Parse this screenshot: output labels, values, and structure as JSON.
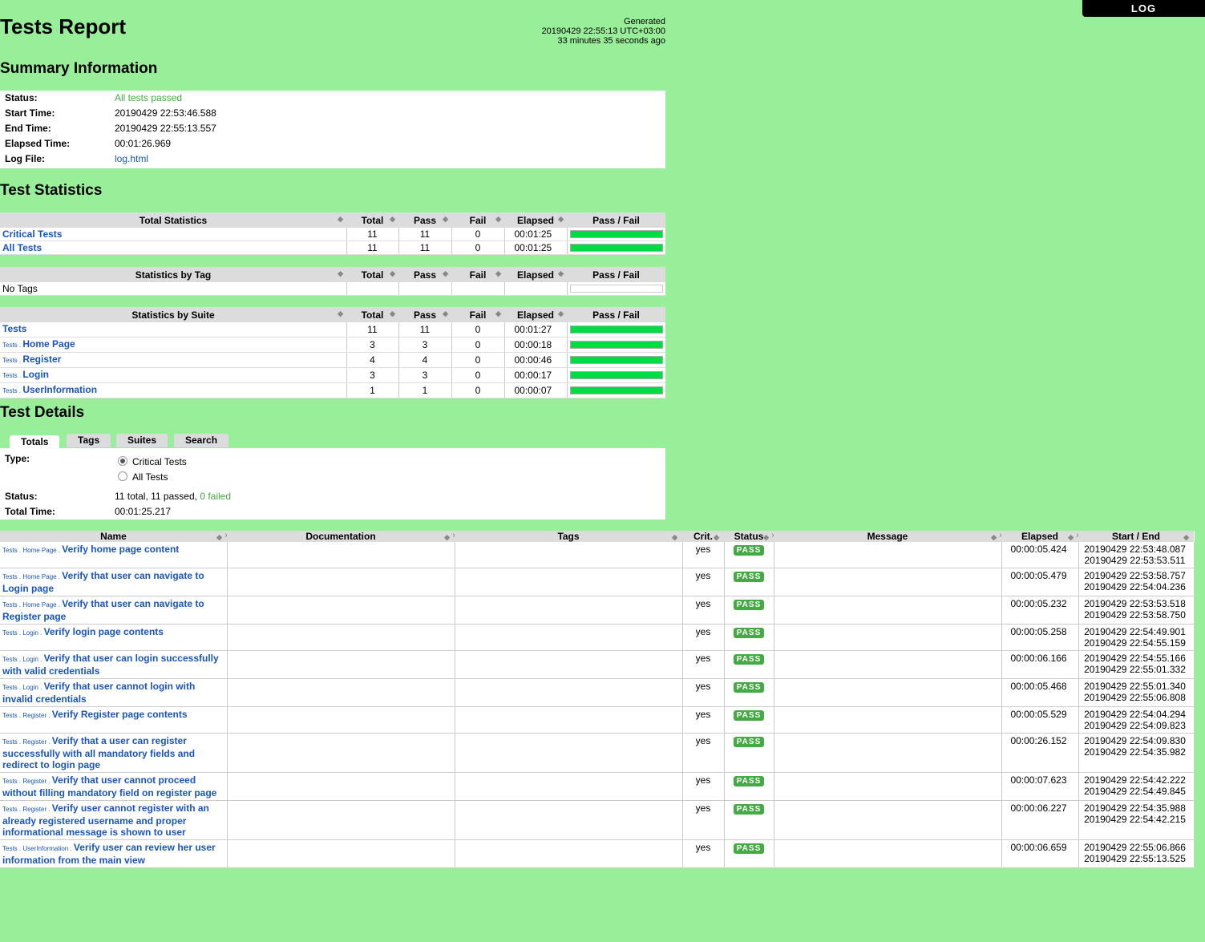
{
  "header": {
    "title": "Tests Report",
    "generated_label": "Generated",
    "generated_time": "20190429 22:55:13 UTC+03:00",
    "generated_ago": "33 minutes 35 seconds ago",
    "log_button": "LOG"
  },
  "summary": {
    "heading": "Summary Information",
    "status_label": "Status:",
    "status_value": "All tests passed",
    "start_label": "Start Time:",
    "start_value": "20190429 22:53:46.588",
    "end_label": "End Time:",
    "end_value": "20190429 22:55:13.557",
    "elapsed_label": "Elapsed Time:",
    "elapsed_value": "00:01:26.969",
    "logfile_label": "Log File:",
    "logfile_value": "log.html"
  },
  "statistics": {
    "heading": "Test Statistics",
    "cols": {
      "total": "Total",
      "pass": "Pass",
      "fail": "Fail",
      "elapsed": "Elapsed",
      "passfail": "Pass / Fail"
    },
    "total_title": "Total Statistics",
    "total_rows": [
      {
        "name": "Critical Tests",
        "total": "11",
        "pass": "11",
        "fail": "0",
        "elapsed": "00:01:25"
      },
      {
        "name": "All Tests",
        "total": "11",
        "pass": "11",
        "fail": "0",
        "elapsed": "00:01:25"
      }
    ],
    "tag_title": "Statistics by Tag",
    "tag_rows": [
      {
        "name": "No Tags"
      }
    ],
    "suite_title": "Statistics by Suite",
    "suite_rows": [
      {
        "prefix": "",
        "name": "Tests",
        "total": "11",
        "pass": "11",
        "fail": "0",
        "elapsed": "00:01:27"
      },
      {
        "prefix": "Tests . ",
        "name": "Home Page",
        "total": "3",
        "pass": "3",
        "fail": "0",
        "elapsed": "00:00:18"
      },
      {
        "prefix": "Tests . ",
        "name": "Register",
        "total": "4",
        "pass": "4",
        "fail": "0",
        "elapsed": "00:00:46"
      },
      {
        "prefix": "Tests . ",
        "name": "Login",
        "total": "3",
        "pass": "3",
        "fail": "0",
        "elapsed": "00:00:17"
      },
      {
        "prefix": "Tests . ",
        "name": "UserInformation",
        "total": "1",
        "pass": "1",
        "fail": "0",
        "elapsed": "00:00:07"
      }
    ]
  },
  "details": {
    "heading": "Test Details",
    "tabs": [
      "Totals",
      "Tags",
      "Suites",
      "Search"
    ],
    "type_label": "Type:",
    "option_critical": "Critical Tests",
    "option_all": "All Tests",
    "status_label": "Status:",
    "status_total": "11 total, 11 passed,",
    "status_failed": "0 failed",
    "totaltime_label": "Total Time:",
    "totaltime_value": "00:01:25.217",
    "columns": {
      "name": "Name",
      "doc": "Documentation",
      "tags": "Tags",
      "crit": "Crit.",
      "status": "Status",
      "message": "Message",
      "elapsed": "Elapsed",
      "startend": "Start / End"
    },
    "rows": [
      {
        "prefix": "Tests . Home Page . ",
        "name": "Verify home page content",
        "crit": "yes",
        "status": "PASS",
        "elapsed": "00:00:05.424",
        "start": "20190429 22:53:48.087",
        "end": "20190429 22:53:53.511"
      },
      {
        "prefix": "Tests . Home Page . ",
        "name": "Verify that user can navigate to Login page",
        "crit": "yes",
        "status": "PASS",
        "elapsed": "00:00:05.479",
        "start": "20190429 22:53:58.757",
        "end": "20190429 22:54:04.236"
      },
      {
        "prefix": "Tests . Home Page . ",
        "name": "Verify that user can navigate to Register page",
        "crit": "yes",
        "status": "PASS",
        "elapsed": "00:00:05.232",
        "start": "20190429 22:53:53.518",
        "end": "20190429 22:53:58.750"
      },
      {
        "prefix": "Tests . Login . ",
        "name": "Verify login page contents",
        "crit": "yes",
        "status": "PASS",
        "elapsed": "00:00:05.258",
        "start": "20190429 22:54:49.901",
        "end": "20190429 22:54:55.159"
      },
      {
        "prefix": "Tests . Login . ",
        "name": "Verify that user can login successfully with valid credentials",
        "crit": "yes",
        "status": "PASS",
        "elapsed": "00:00:06.166",
        "start": "20190429 22:54:55.166",
        "end": "20190429 22:55:01.332"
      },
      {
        "prefix": "Tests . Login . ",
        "name": "Verify that user cannot login with invalid credentials",
        "crit": "yes",
        "status": "PASS",
        "elapsed": "00:00:05.468",
        "start": "20190429 22:55:01.340",
        "end": "20190429 22:55:06.808"
      },
      {
        "prefix": "Tests . Register . ",
        "name": "Verify Register page contents",
        "crit": "yes",
        "status": "PASS",
        "elapsed": "00:00:05.529",
        "start": "20190429 22:54:04.294",
        "end": "20190429 22:54:09.823"
      },
      {
        "prefix": "Tests . Register . ",
        "name": "Verify that a user can register successfully with all mandatory fields and redirect to login page",
        "crit": "yes",
        "status": "PASS",
        "elapsed": "00:00:26.152",
        "start": "20190429 22:54:09.830",
        "end": "20190429 22:54:35.982"
      },
      {
        "prefix": "Tests . Register . ",
        "name": "Verify that user cannot proceed without filling mandatory field on register page",
        "crit": "yes",
        "status": "PASS",
        "elapsed": "00:00:07.623",
        "start": "20190429 22:54:42.222",
        "end": "20190429 22:54:49.845"
      },
      {
        "prefix": "Tests . Register . ",
        "name": "Verify user cannot register with an already registered username and proper informational message is shown to user",
        "crit": "yes",
        "status": "PASS",
        "elapsed": "00:00:06.227",
        "start": "20190429 22:54:35.988",
        "end": "20190429 22:54:42.215"
      },
      {
        "prefix": "Tests . UserInformation . ",
        "name": "Verify user can review her user information from the main view",
        "crit": "yes",
        "status": "PASS",
        "elapsed": "00:00:06.659",
        "start": "20190429 22:55:06.866",
        "end": "20190429 22:55:13.525"
      }
    ]
  },
  "colors": {
    "background": "#99ee99",
    "pass_bar": "#00dd44",
    "link": "#1a55bb",
    "badge": "#44aa44"
  }
}
